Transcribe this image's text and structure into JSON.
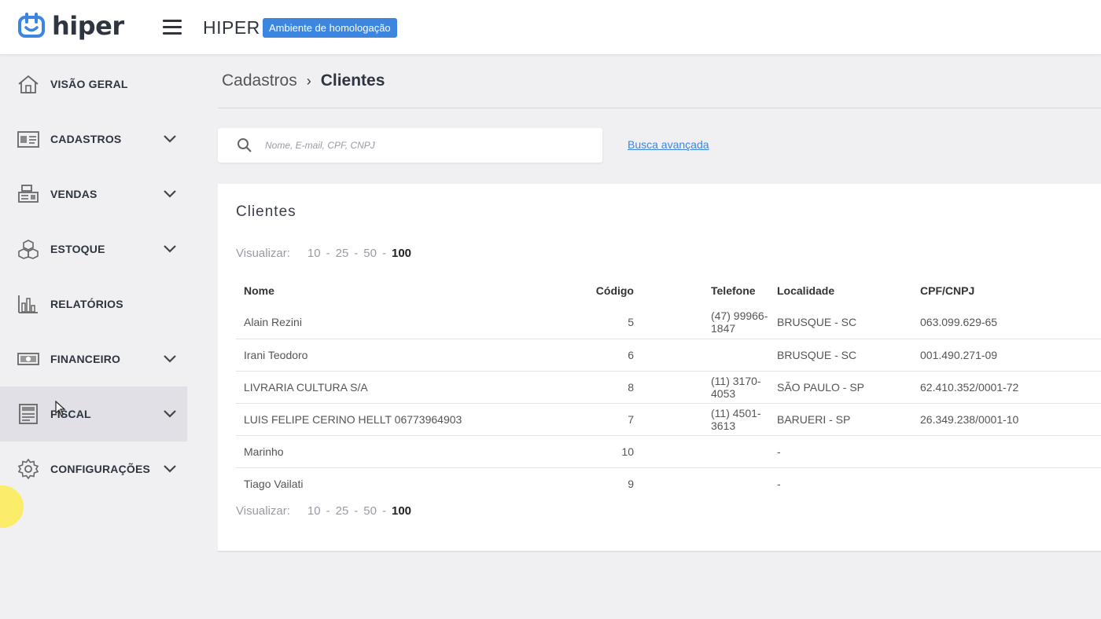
{
  "topbar": {
    "logo_text": "hiper",
    "app_name": "HIPER",
    "env_badge": "Ambiente de homologação"
  },
  "sidebar": {
    "items": [
      {
        "label": "VISÃO GERAL",
        "icon": "home-icon",
        "expandable": false
      },
      {
        "label": "CADASTROS",
        "icon": "id-card-icon",
        "expandable": true
      },
      {
        "label": "VENDAS",
        "icon": "cash-register-icon",
        "expandable": true
      },
      {
        "label": "ESTOQUE",
        "icon": "boxes-icon",
        "expandable": true
      },
      {
        "label": "RELATÓRIOS",
        "icon": "bar-chart-icon",
        "expandable": false
      },
      {
        "label": "FINANCEIRO",
        "icon": "money-icon",
        "expandable": true
      },
      {
        "label": "FISCAL",
        "icon": "document-icon",
        "expandable": true,
        "active": true
      },
      {
        "label": "CONFIGURAÇÕES",
        "icon": "gear-icon",
        "expandable": true
      }
    ]
  },
  "breadcrumb": {
    "parent": "Cadastros",
    "current": "Clientes"
  },
  "search": {
    "placeholder": "Nome, E-mail, CPF, CNPJ",
    "value": "",
    "advanced_link": "Busca avançada"
  },
  "card": {
    "title": "Clientes",
    "pager": {
      "label": "Visualizar:",
      "options": [
        "10",
        "25",
        "50",
        "100"
      ],
      "selected": "100"
    },
    "table": {
      "columns": [
        "Nome",
        "Código",
        "Telefone",
        "Localidade",
        "CPF/CNPJ"
      ],
      "rows": [
        [
          "Alain Rezini",
          "5",
          "(47) 99966-1847",
          "BRUSQUE - SC",
          "063.099.629-65"
        ],
        [
          "Irani Teodoro",
          "6",
          "",
          "BRUSQUE - SC",
          "001.490.271-09"
        ],
        [
          "LIVRARIA CULTURA S/A",
          "8",
          "(11) 3170-4053",
          "SÃO PAULO - SP",
          "62.410.352/0001-72"
        ],
        [
          "LUIS FELIPE CERINO HELLT 06773964903",
          "7",
          "(11) 4501-3613",
          "BARUERI - SP",
          "26.349.238/0001-10"
        ],
        [
          "Marinho",
          "10",
          "",
          "-",
          ""
        ],
        [
          "Tiago Vailati",
          "9",
          "",
          "-",
          ""
        ]
      ]
    }
  }
}
